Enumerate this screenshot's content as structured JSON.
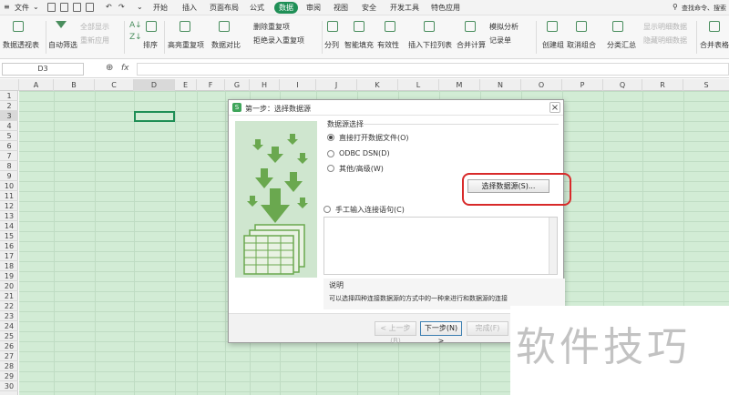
{
  "menubar": {
    "file": "文件",
    "tabs": [
      "开始",
      "插入",
      "页面布局",
      "公式",
      "数据",
      "审阅",
      "视图",
      "安全",
      "开发工具",
      "特色应用"
    ],
    "active_tab": "数据",
    "search": "查找命令、搜索"
  },
  "ribbon": {
    "pivot": "数据透视表",
    "autofilter": "自动筛选",
    "show_all": "全部显示",
    "reapply": "重新应用",
    "sort": "排序",
    "highlight_dup": "高亮重复项",
    "data_compare": "数据对比",
    "remove_dup": "删除重复项",
    "reject_dup": "拒绝录入重复项",
    "split_col": "分列",
    "smart_fill": "智能填充",
    "validity": "有效性",
    "dropdown": "插入下拉列表",
    "consolidate": "合并计算",
    "simulate": "模拟分析",
    "record": "记录单",
    "group": "创建组",
    "ungroup": "取消组合",
    "subtotal": "分类汇总",
    "show_detail": "显示明细数据",
    "hide_detail": "隐藏明细数据",
    "merge_tables": "合并表格"
  },
  "formula_bar": {
    "name_box": "D3",
    "fx": "fx",
    "value": ""
  },
  "sheet": {
    "columns": [
      "A",
      "B",
      "C",
      "D",
      "E",
      "F",
      "G",
      "H",
      "I",
      "J",
      "K",
      "L",
      "M",
      "N",
      "O",
      "P",
      "Q",
      "R",
      "S"
    ],
    "rows": [
      "1",
      "2",
      "3",
      "4",
      "5",
      "6",
      "7",
      "8",
      "9",
      "10",
      "11",
      "12",
      "13",
      "14",
      "15",
      "16",
      "17",
      "18",
      "19",
      "20",
      "21",
      "22",
      "23",
      "24",
      "25",
      "26",
      "27",
      "28",
      "29",
      "30"
    ],
    "selected_cell": "D3"
  },
  "dialog": {
    "title": "第一步：选择数据源",
    "close": "×",
    "group_label": "数据源选择",
    "option_direct": "直接打开数据文件(O)",
    "option_odbc": "ODBC DSN(D)",
    "option_other": "其他/高级(W)",
    "select_button": "选择数据源(S)...",
    "option_manual": "手工输入连接语句(C)",
    "desc_label": "说明",
    "desc_text": "可以选择四种连接数据源的方式中的一种来进行和数据源的连接",
    "btn_prev": "< 上一步(B)",
    "btn_next": "下一步(N) >",
    "btn_finish": "完成(F)"
  },
  "watermark": "软件技巧"
}
